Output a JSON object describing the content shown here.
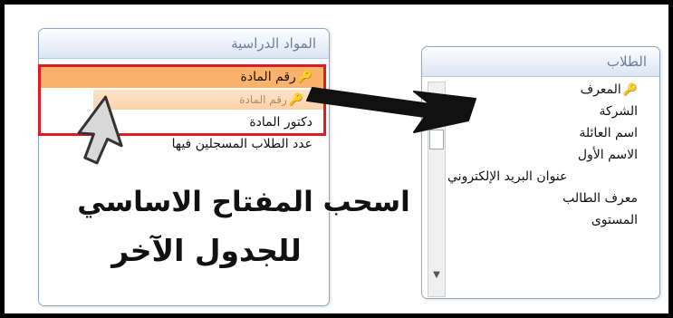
{
  "left_table": {
    "title": "المواد الدراسية",
    "fields": [
      "رقم المادة",
      "رقم المادة",
      "دكتور المادة",
      "عدد الطلاب المسجلين فيها"
    ],
    "key_field_index": 0,
    "ghost_label": "رقم المادة"
  },
  "right_table": {
    "title": "الطلاب",
    "fields": [
      "المعرف",
      "الشركة",
      "اسم العائلة",
      "الاسم الأول",
      "عنوان البريد الإلكتروني",
      "معرف الطالب",
      "المستوى"
    ],
    "key_field_index": 0
  },
  "caption": {
    "line1": "اسحب المفتاح الاساسي",
    "line2": "للجدول الآخر"
  },
  "icons": {
    "key": "key-icon",
    "cursor": "mouse-pointer-icon",
    "arrow": "drag-arrow-icon",
    "scroll_up": "scroll-up-icon",
    "scroll_down": "scroll-down-icon"
  },
  "colors": {
    "highlight": "#fbb26a",
    "red_outline": "#e01b24",
    "title_text": "#6d7f9d"
  }
}
